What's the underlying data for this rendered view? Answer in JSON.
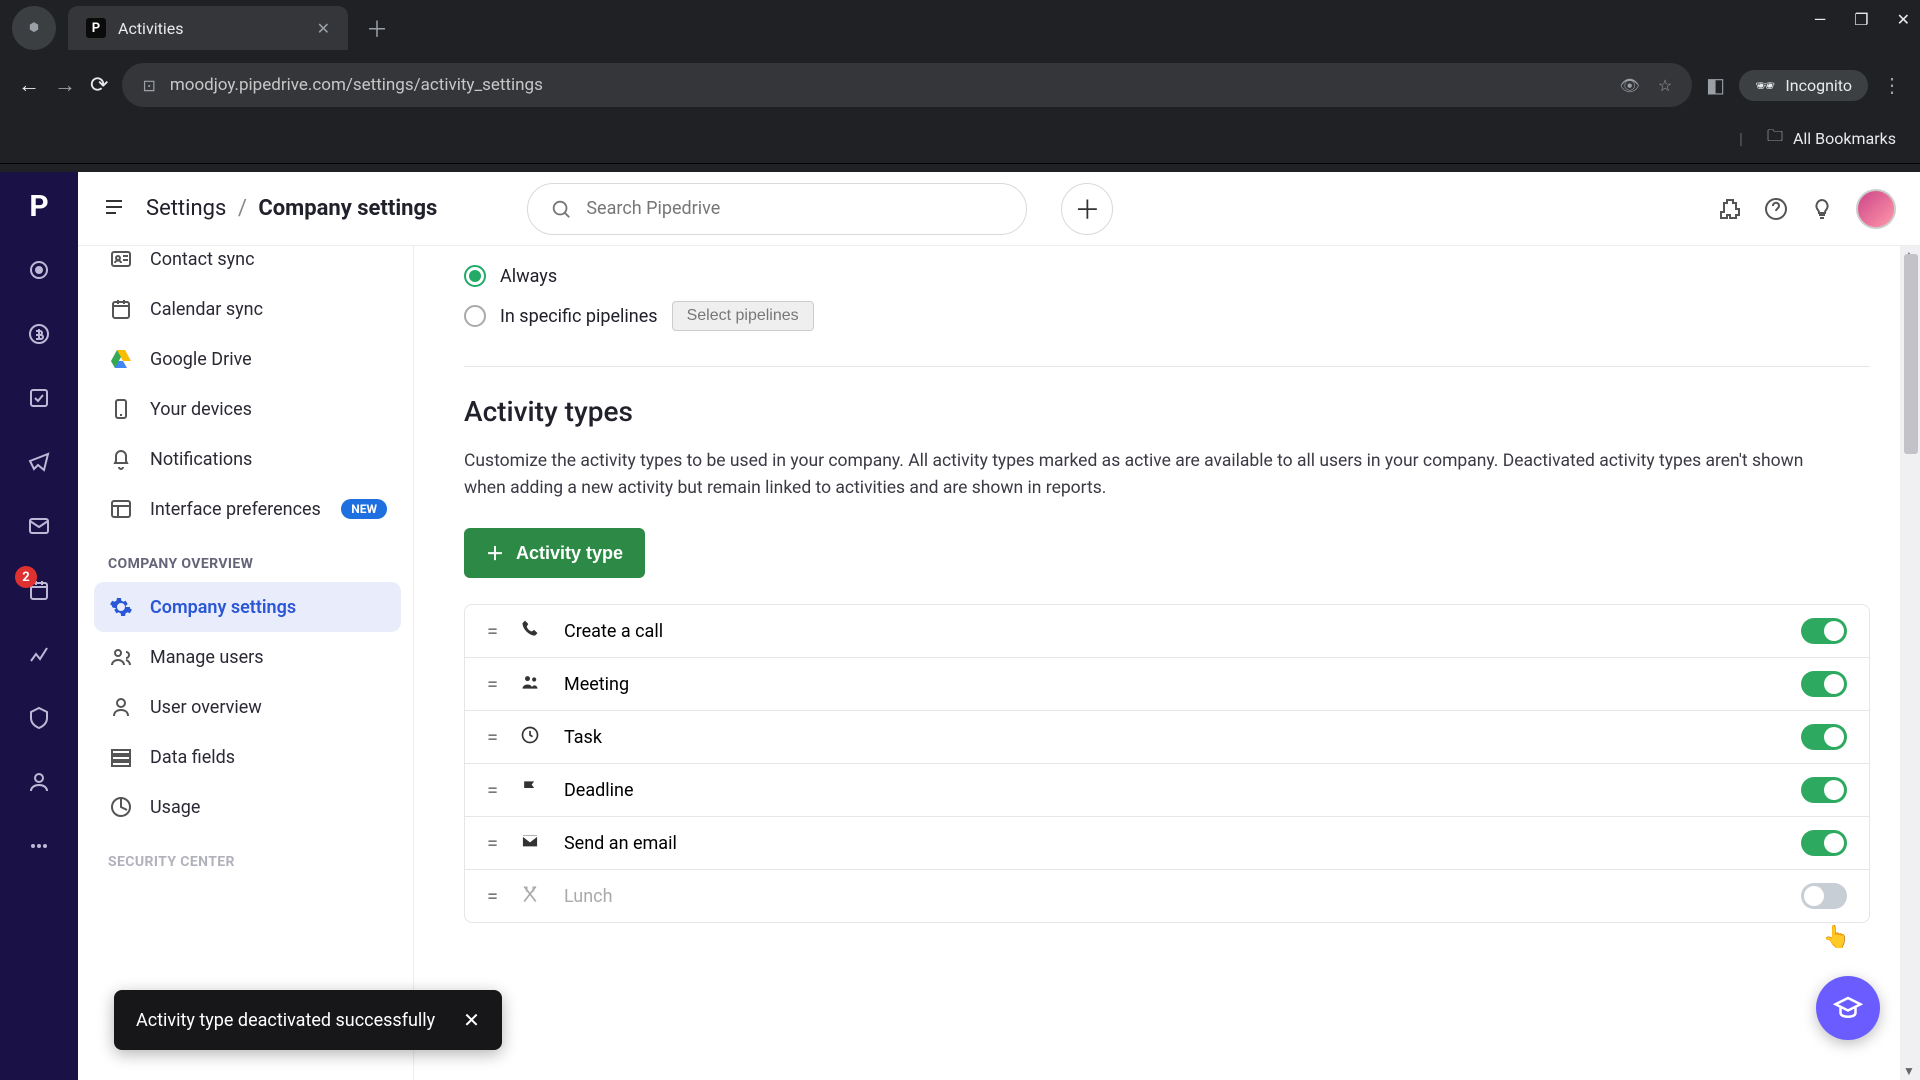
{
  "browser": {
    "tab_title": "Activities",
    "tab_favicon_letter": "P",
    "url": "moodjoy.pipedrive.com/settings/activity_settings",
    "incognito_label": "Incognito",
    "all_bookmarks": "All Bookmarks"
  },
  "rail": {
    "logo_letter": "P",
    "badge_value": "2"
  },
  "header": {
    "breadcrumb_root": "Settings",
    "breadcrumb_sep": "/",
    "breadcrumb_current": "Company settings",
    "search_placeholder": "Search Pipedrive"
  },
  "sidebar": {
    "items_top": [
      {
        "label": "Contact sync",
        "icon": "id"
      },
      {
        "label": "Calendar sync",
        "icon": "cal"
      },
      {
        "label": "Google Drive",
        "icon": "gdrive"
      },
      {
        "label": "Your devices",
        "icon": "device"
      },
      {
        "label": "Notifications",
        "icon": "bell"
      },
      {
        "label": "Interface preferences",
        "icon": "layout",
        "new": true
      }
    ],
    "new_badge": "NEW",
    "section_company": "COMPANY OVERVIEW",
    "items_company": [
      {
        "label": "Company settings",
        "icon": "gear",
        "active": true
      },
      {
        "label": "Manage users",
        "icon": "users"
      },
      {
        "label": "User overview",
        "icon": "user"
      },
      {
        "label": "Data fields",
        "icon": "fields"
      },
      {
        "label": "Usage",
        "icon": "usage"
      }
    ],
    "section_security": "SECURITY CENTER"
  },
  "radios": {
    "always": "Always",
    "specific": "In specific pipelines",
    "select_btn": "Select pipelines"
  },
  "section": {
    "title": "Activity types",
    "description": "Customize the activity types to be used in your company. All activity types marked as active are available to all users in your company. Deactivated activity types aren't shown when adding a new activity but remain linked to activities and are shown in reports.",
    "add_button": "Activity type"
  },
  "activity_types": [
    {
      "label": "Create a call",
      "icon": "call",
      "active": true
    },
    {
      "label": "Meeting",
      "icon": "meeting",
      "active": true
    },
    {
      "label": "Task",
      "icon": "task",
      "active": true
    },
    {
      "label": "Deadline",
      "icon": "flag",
      "active": true
    },
    {
      "label": "Send an email",
      "icon": "email",
      "active": true
    },
    {
      "label": "Lunch",
      "icon": "lunch",
      "active": false
    }
  ],
  "toast": {
    "message": "Activity type deactivated successfully"
  }
}
